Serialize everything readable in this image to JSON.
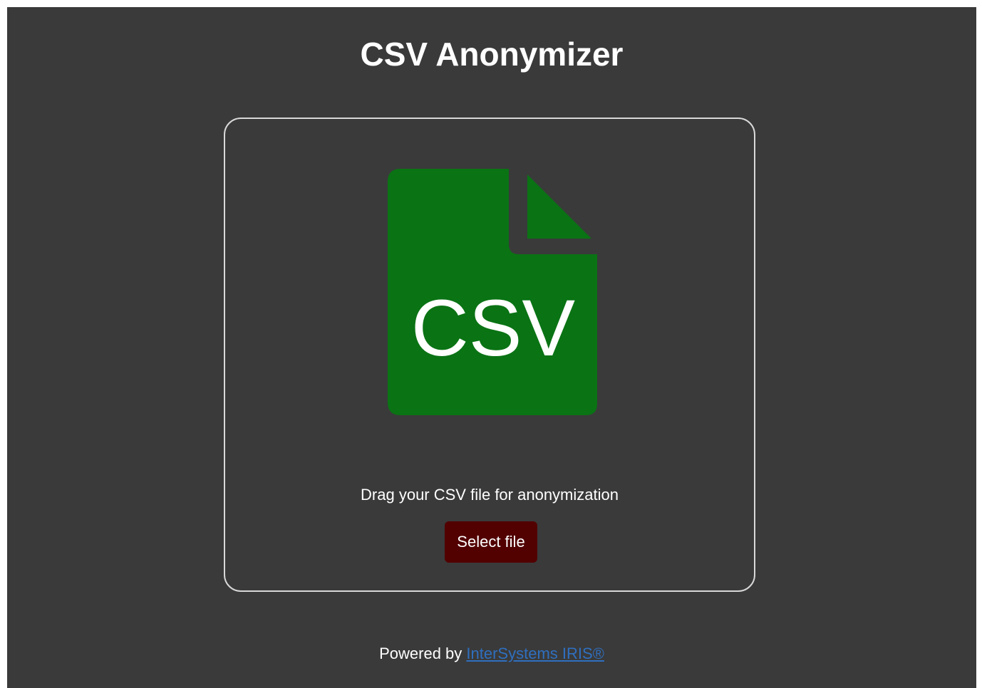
{
  "header": {
    "title": "CSV Anonymizer"
  },
  "drop_zone": {
    "icon": {
      "name": "csv-file-icon",
      "label": "CSV",
      "color": "#0a7314"
    },
    "hint": "Drag your CSV file for anonymization",
    "select_button_label": "Select file",
    "select_button_color": "#520000"
  },
  "footer": {
    "prefix": "Powered by",
    "link_label": "InterSystems IRIS®",
    "link_color": "#2f6fbf"
  },
  "theme": {
    "background": "#3a3a3a",
    "border": "#d8d8d8",
    "text": "#ffffff"
  }
}
